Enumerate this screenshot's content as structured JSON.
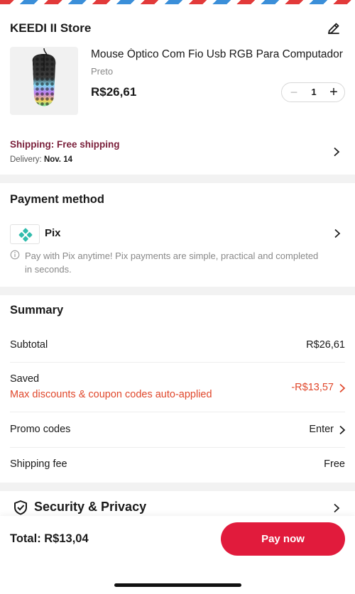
{
  "store": {
    "name": "KEEDI II Store",
    "product": {
      "title": "Mouse Óptico Com Fio Usb RGB Para Computador",
      "variant": "Preto",
      "price": "R$26,61",
      "quantity": "1"
    },
    "shipping_label": "Shipping: Free shipping",
    "delivery_label": "Delivery:",
    "delivery_date": "Nov. 14"
  },
  "payment": {
    "title": "Payment method",
    "method": "Pix",
    "note": "Pay with Pix anytime! Pix payments are simple, practical and completed in seconds."
  },
  "summary": {
    "title": "Summary",
    "subtotal_label": "Subtotal",
    "subtotal_value": "R$26,61",
    "saved_label": "Saved",
    "saved_note": "Max discounts & coupon codes auto-applied",
    "saved_value": "-R$13,57",
    "promo_label": "Promo codes",
    "promo_value": "Enter",
    "shipping_fee_label": "Shipping fee",
    "shipping_fee_value": "Free"
  },
  "security": {
    "title": "Security & Privacy"
  },
  "checkout": {
    "total_label": "Total: R$13,04",
    "pay_button": "Pay now"
  },
  "colors": {
    "accent": "#e11b3c",
    "discount": "#e0472b",
    "shipping_text": "#7a1f3a",
    "pix": "#32bcad"
  }
}
